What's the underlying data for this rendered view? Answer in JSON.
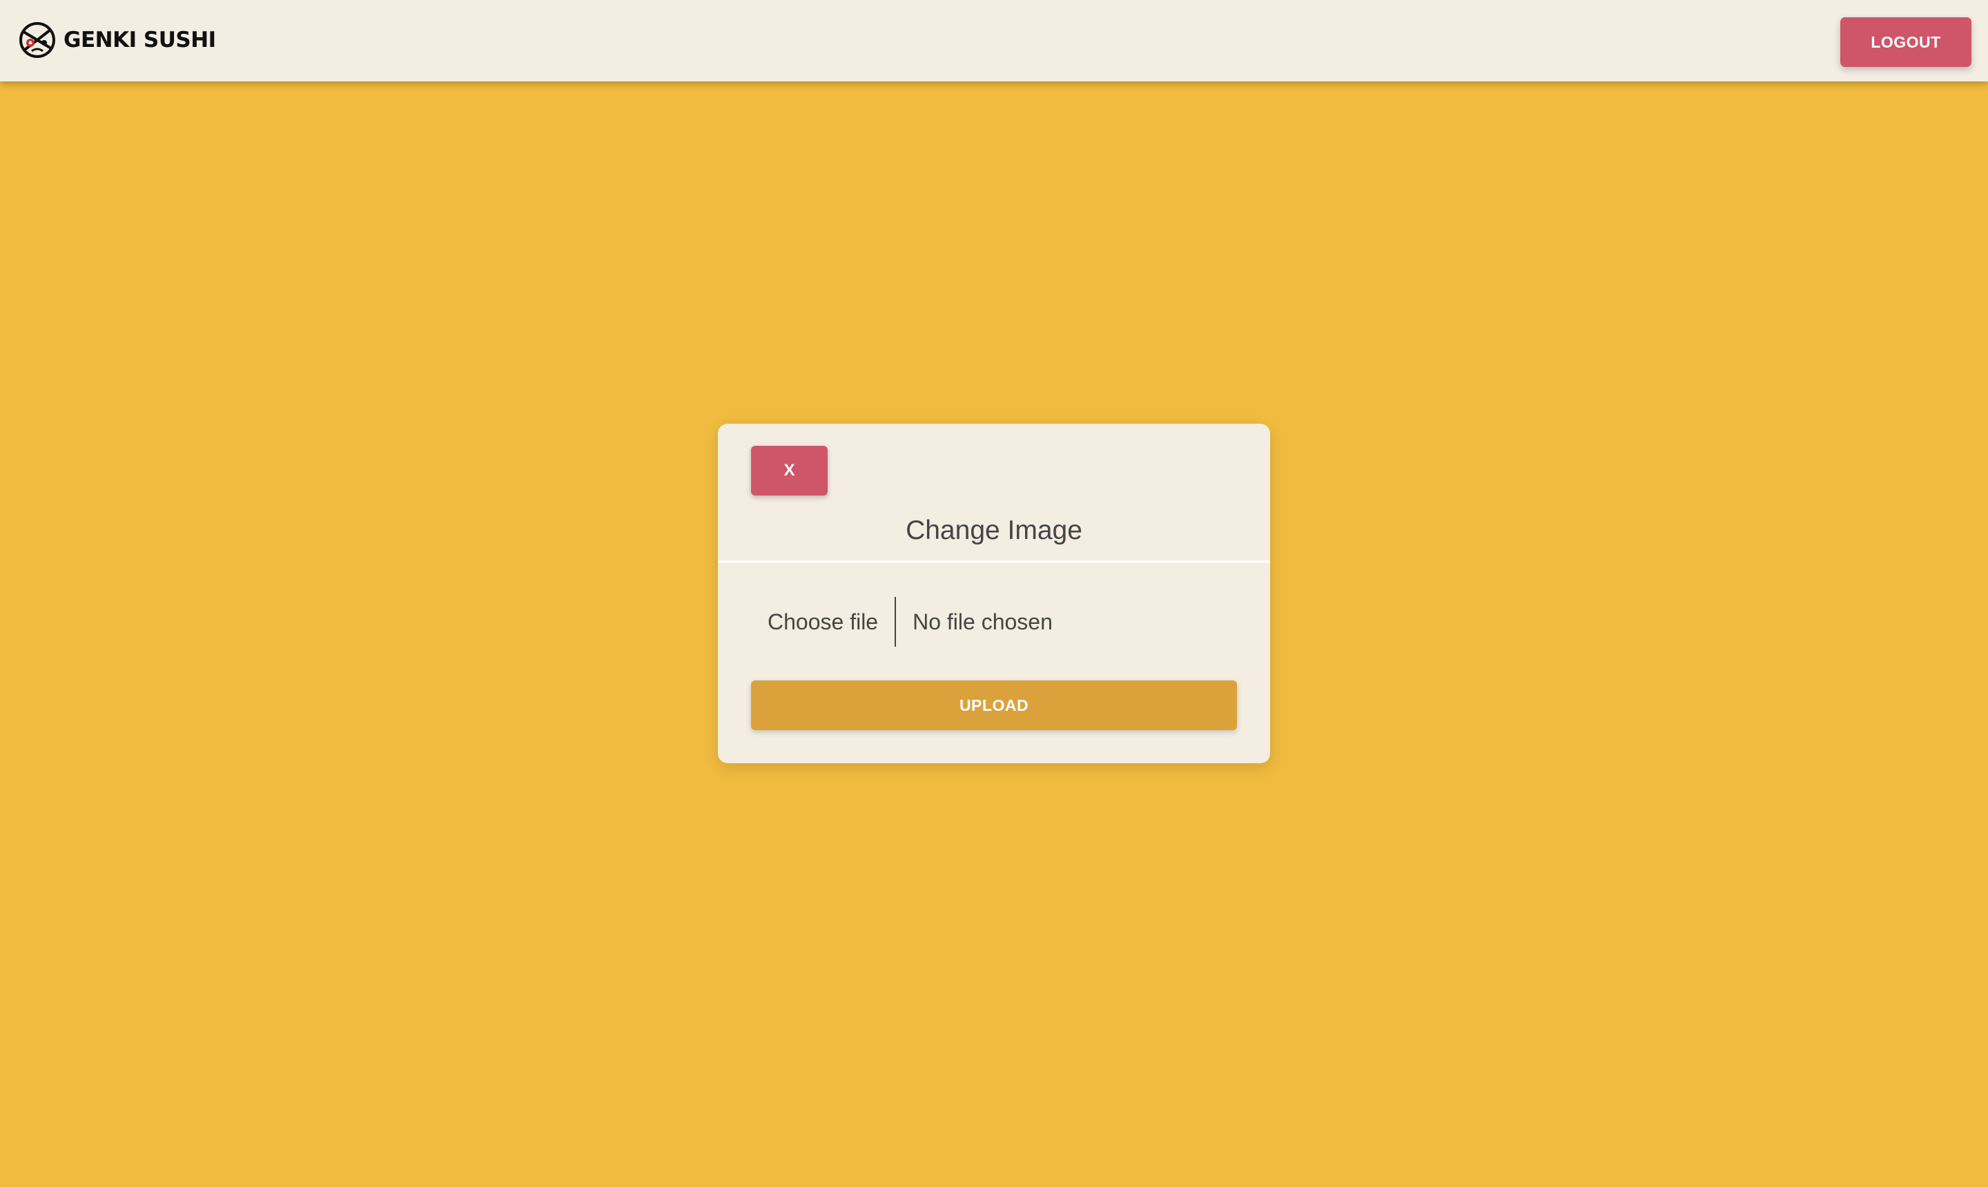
{
  "header": {
    "brand_name": "GENKI SUSHI",
    "logout_label": "LOGOUT"
  },
  "modal": {
    "close_label": "X",
    "title": "Change Image",
    "file_input": {
      "button_label": "Choose file",
      "status": "No file chosen"
    },
    "upload_label": "UPLOAD"
  },
  "colors": {
    "page_background": "#f0bb3f",
    "surface": "#f3ede2",
    "danger_button": "#cf5569",
    "upload_button": "#dba23c",
    "text": "#454545"
  },
  "icons": {
    "brand_logo": "genki-sushi-logo-icon"
  }
}
